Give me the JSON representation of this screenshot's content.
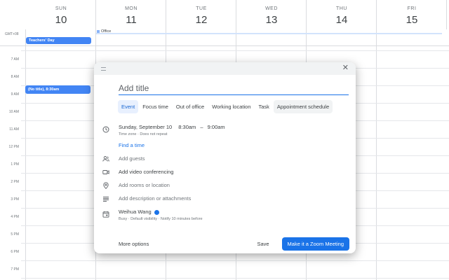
{
  "header": {
    "timezone": "GMT+08",
    "days": [
      {
        "dow": "SUN",
        "num": "10"
      },
      {
        "dow": "MON",
        "num": "11"
      },
      {
        "dow": "TUE",
        "num": "12"
      },
      {
        "dow": "WED",
        "num": "13"
      },
      {
        "dow": "THU",
        "num": "14"
      },
      {
        "dow": "FRI",
        "num": "15"
      }
    ]
  },
  "hours": [
    "7 AM",
    "8 AM",
    "9 AM",
    "10 AM",
    "11 AM",
    "12 PM",
    "1 PM",
    "2 PM",
    "3 PM",
    "4 PM",
    "5 PM",
    "6 PM",
    "7 PM"
  ],
  "events": {
    "teachers_day": "Teachers' Day",
    "office": "Office",
    "no_title": "(No title), 8:30am"
  },
  "colors": {
    "event_blue": "#4285f4",
    "accent": "#1a73e8"
  },
  "dialog": {
    "title_placeholder": "Add title",
    "tabs": [
      "Event",
      "Focus time",
      "Out of office",
      "Working location",
      "Task",
      "Appointment schedule"
    ],
    "date": "Sunday, September 10",
    "start": "8:30am",
    "dash": "–",
    "end": "9:00am",
    "tz_note": "Time zone · Does not repeat",
    "find_time": "Find a time",
    "add_guests": "Add guests",
    "add_video": "Add video conferencing",
    "add_rooms": "Add rooms or location",
    "add_desc": "Add description or attachments",
    "owner": "Weihua Wang",
    "owner_note": "Busy · Default visibility · Notify 10 minutes before",
    "more_options": "More options",
    "save": "Save",
    "zoom": "Make it a Zoom Meeting"
  }
}
